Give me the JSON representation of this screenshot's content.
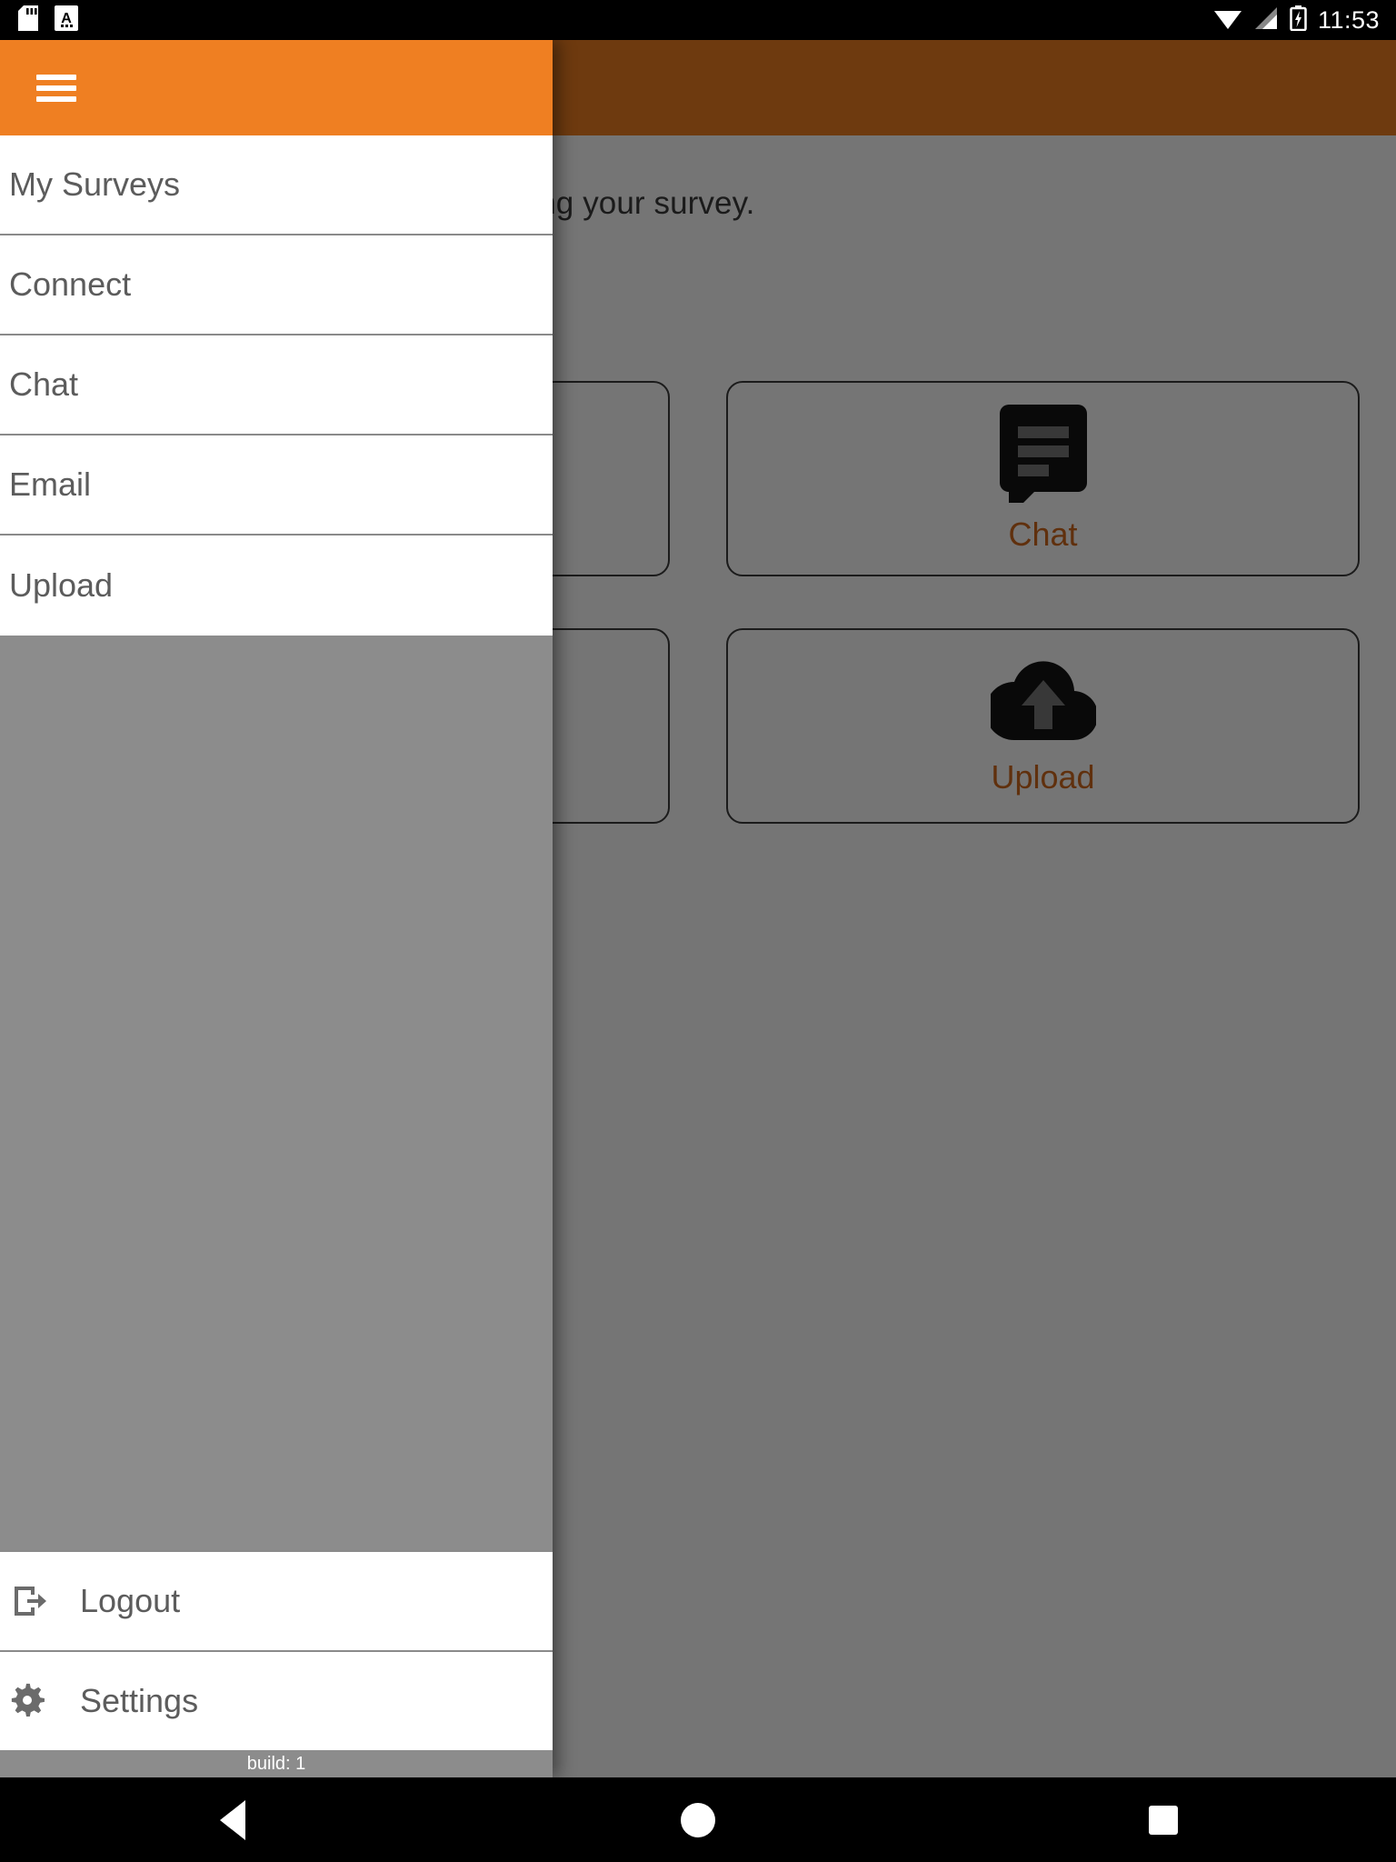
{
  "status_bar": {
    "icons": [
      "sd-card-icon",
      "keyboard-input-icon"
    ],
    "wifi": "wifi-icon",
    "signal": "cell-signal-icon",
    "battery": "battery-charging-icon",
    "time": "11:53"
  },
  "app": {
    "toolbar_color": "#EF7F22",
    "subtitle": "Here you can see all details regarding your survey.",
    "cards": [
      {
        "label": "",
        "icon": "card-icon-left-top"
      },
      {
        "label": "Chat",
        "icon": "chat-bubble-icon"
      },
      {
        "label": "",
        "icon": "card-icon-left-bottom"
      },
      {
        "label": "Upload",
        "icon": "cloud-upload-icon"
      }
    ],
    "accent_color": "#D2691E"
  },
  "drawer": {
    "header": {
      "menu_icon": "hamburger-icon",
      "background": "#EF7F22"
    },
    "items": [
      {
        "label": "My Surveys"
      },
      {
        "label": "Connect"
      },
      {
        "label": "Chat"
      },
      {
        "label": "Email"
      },
      {
        "label": "Upload"
      }
    ],
    "footer": [
      {
        "label": "Logout",
        "icon": "logout-icon"
      },
      {
        "label": "Settings",
        "icon": "gear-icon"
      }
    ],
    "build_text": "build: 1"
  },
  "navbar": {
    "back": "back-triangle-icon",
    "home": "home-circle-icon",
    "recents": "recents-square-icon"
  }
}
